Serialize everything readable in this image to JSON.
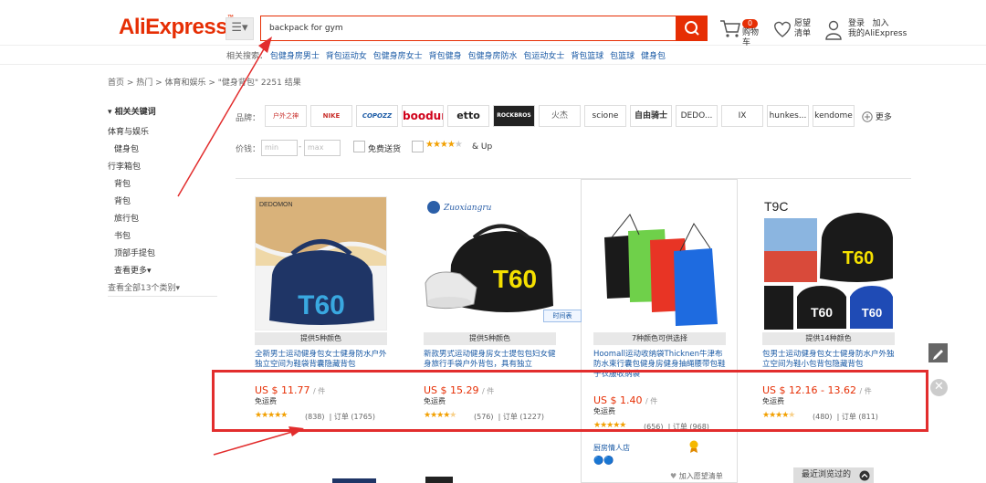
{
  "header": {
    "logo": "AliExpress",
    "menu_icon": "☰▾",
    "search_value": "backpack for gym",
    "cart_badge": "0",
    "cart_label": "购物车",
    "wishlist_label": "愿望清单",
    "signin_label": "登录",
    "join_label": "加入",
    "my_aliexpress": "我的AliExpress"
  },
  "related": {
    "label": "相关搜索：",
    "items": [
      "包健身房男士",
      "背包运动女",
      "包健身房女士",
      "背包健身",
      "包健身房防水",
      "包运动女士",
      "背包篮球",
      "包篮球",
      "健身包"
    ]
  },
  "breadcrumb": "首页 > 热门 > 体育和娱乐 > \"健身背包\" 2251 结果",
  "sidebar": {
    "title": "▾ 相关关键词",
    "items": [
      {
        "label": "体育与娱乐",
        "sub": false
      },
      {
        "label": "健身包",
        "sub": true
      },
      {
        "label": "行李箱包",
        "sub": false
      },
      {
        "label": "背包",
        "sub": true
      },
      {
        "label": "背包",
        "sub": true
      },
      {
        "label": "旅行包",
        "sub": true
      },
      {
        "label": "书包",
        "sub": true
      },
      {
        "label": "顶部手提包",
        "sub": true
      }
    ],
    "more": "查看更多▾",
    "all_categories": "查看全部13个类别▾"
  },
  "filters": {
    "brand_label": "品牌：",
    "brands": [
      "户外之神",
      "NIKE",
      "COPOZZ",
      "boodun",
      "etto",
      "ROCKBROS",
      "火杰",
      "scione",
      "自由骑士",
      "DEDO...",
      "IX",
      "hunkes...",
      "kendome"
    ],
    "brands_more": "更多",
    "price_label": "价钱：",
    "price_min": "min",
    "price_max": "max",
    "free_shipping": "免费送货",
    "rating_up": "& Up"
  },
  "products": [
    {
      "brand_tag": "DEDOMON",
      "colors": "提供5种颜色",
      "title": "全新男士运动健身包女士健身防水户外独立空间为鞋袋背囊隐藏背包",
      "price": "US $ 11.77",
      "unit": "/ 件",
      "shipping": "免运费",
      "rating": 5,
      "reviews": "(838)",
      "orders": "| 订单 (1765)"
    },
    {
      "brand_tag": "Zuoxiangru",
      "colors": "提供5种颜色",
      "title": "新款男式运动健身房女士提包包妇女健身旅行手袋户外背包，具有独立",
      "price": "US $ 15.29",
      "unit": "/ 件",
      "shipping": "免运费",
      "rating": 4.5,
      "reviews": "(576)",
      "orders": "| 订单 (1227)",
      "badge": "时间表"
    },
    {
      "colors": "7种颜色可供选择",
      "title": "Hoomall运动收纳袋Thicknen牛津布防水束行囊包健身房健身抽绳腰带包鞋子衣服收纳袋",
      "price": "US $ 1.40",
      "unit": "/ 件",
      "shipping": "免运费",
      "rating": 5,
      "reviews": "(656)",
      "orders": "| 订单 (968)",
      "store": "厨房情人店",
      "wishlist": "加入愿望清单"
    },
    {
      "brand_tag": "T9C",
      "colors": "提供14种颜色",
      "title": "包男士运动健身包女士健身防水户外独立空间为鞋小包背包隐藏背包",
      "price": "US $ 12.16 - 13.62",
      "unit": "/ 件",
      "shipping": "免运费",
      "rating": 4.5,
      "reviews": "(480)",
      "orders": "| 订单 (811)"
    }
  ],
  "recently_viewed": "最近浏览过的",
  "colors": {
    "accent": "#e62e04",
    "link": "#1a5aa5",
    "star": "#f2a002",
    "annotation": "#e22d2d"
  }
}
